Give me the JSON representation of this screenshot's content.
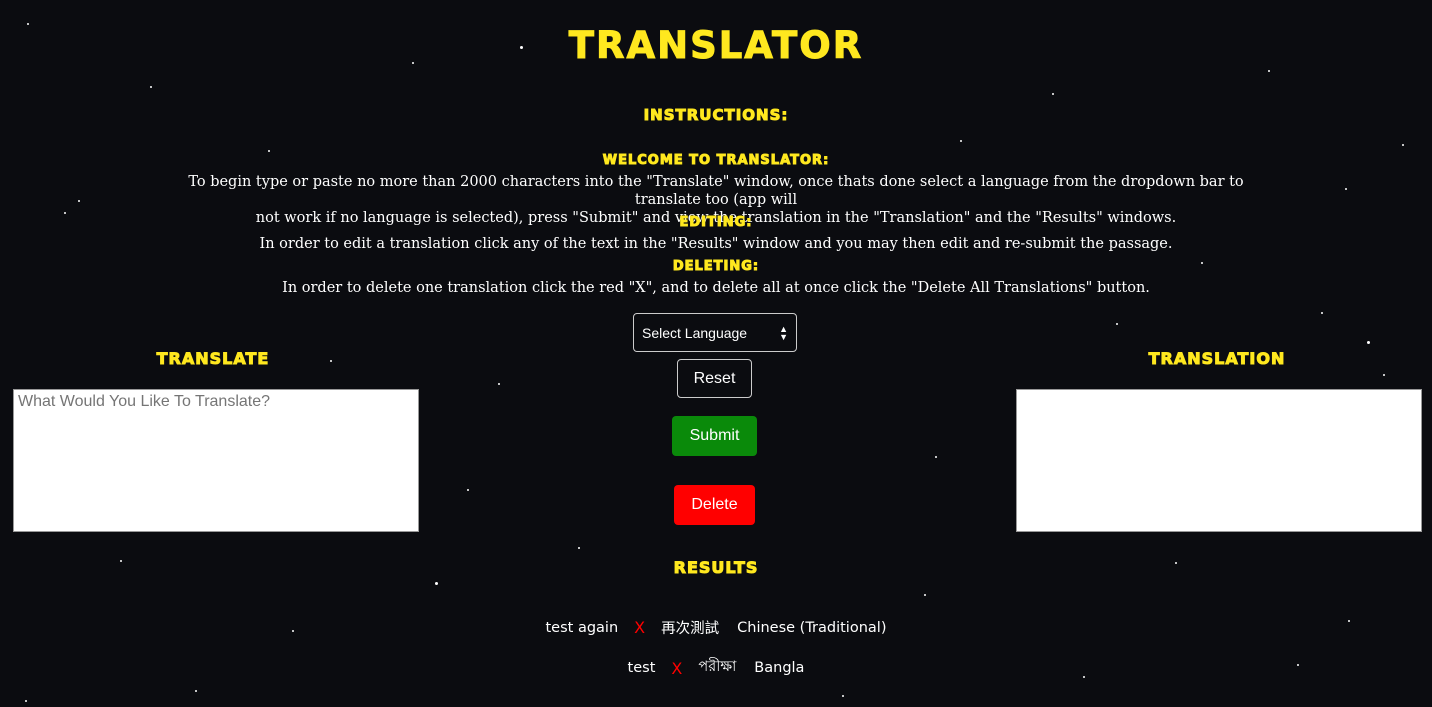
{
  "title": "TRANSLATOR",
  "instructions": {
    "heading": "INSTRUCTIONS:",
    "welcome_heading": "WELCOME TO TRANSLATOR:",
    "welcome_text_line1": "To begin type or paste no more than 2000 characters into the \"Translate\" window, once thats done select a language from the dropdown bar to translate too (app will",
    "welcome_text_line2": "not work if no language is selected), press \"Submit\" and view the translation in the \"Translation\" and the \"Results\" windows.",
    "editing_heading": "EDITING:",
    "editing_text": "In order to edit a translation click any of the text in the \"Results\" window and you may then edit and re-submit the passage.",
    "deleting_heading": "DELETING:",
    "deleting_text": "In order to delete one translation click the red \"X\", and to delete all at once click the \"Delete All Translations\" button."
  },
  "translate": {
    "heading": "TRANSLATE",
    "placeholder": "What Would You Like To Translate?"
  },
  "translation": {
    "heading": "TRANSLATION"
  },
  "controls": {
    "select_label": "Select Language",
    "reset_label": "Reset",
    "submit_label": "Submit",
    "delete_label": "Delete"
  },
  "results": {
    "heading": "RESULTS",
    "items": [
      {
        "source": "test again",
        "delete": "X",
        "translated": "再次測試",
        "language": "Chinese (Traditional)"
      },
      {
        "source": "test",
        "delete": "X",
        "translated": "পরীক্ষা",
        "language": "Bangla"
      }
    ]
  },
  "colors": {
    "background": "#0b0c10",
    "accent": "#ffe81f",
    "submit": "#0a8a0a",
    "delete": "#ff0000"
  }
}
